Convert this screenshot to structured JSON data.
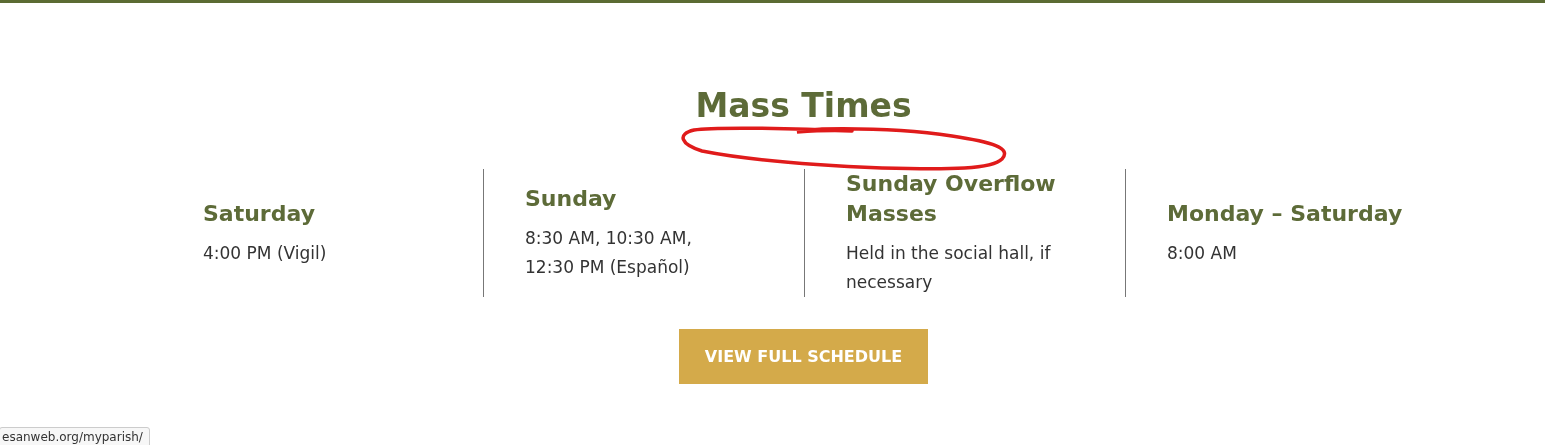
{
  "title": "Mass Times",
  "columns": [
    {
      "heading": "Saturday",
      "lines": [
        "4:00 PM (Vigil)"
      ]
    },
    {
      "heading": "Sunday",
      "lines": [
        "8:30 AM, 10:30 AM,",
        "12:30 PM (Español)"
      ]
    },
    {
      "heading": "Sunday Overflow Masses",
      "lines": [
        "Held in the social hall, if necessary"
      ]
    },
    {
      "heading": "Monday – Saturday",
      "lines": [
        "8:00 AM"
      ]
    }
  ],
  "button": "VIEW FULL SCHEDULE",
  "status_url": "esanweb.org/myparish/"
}
